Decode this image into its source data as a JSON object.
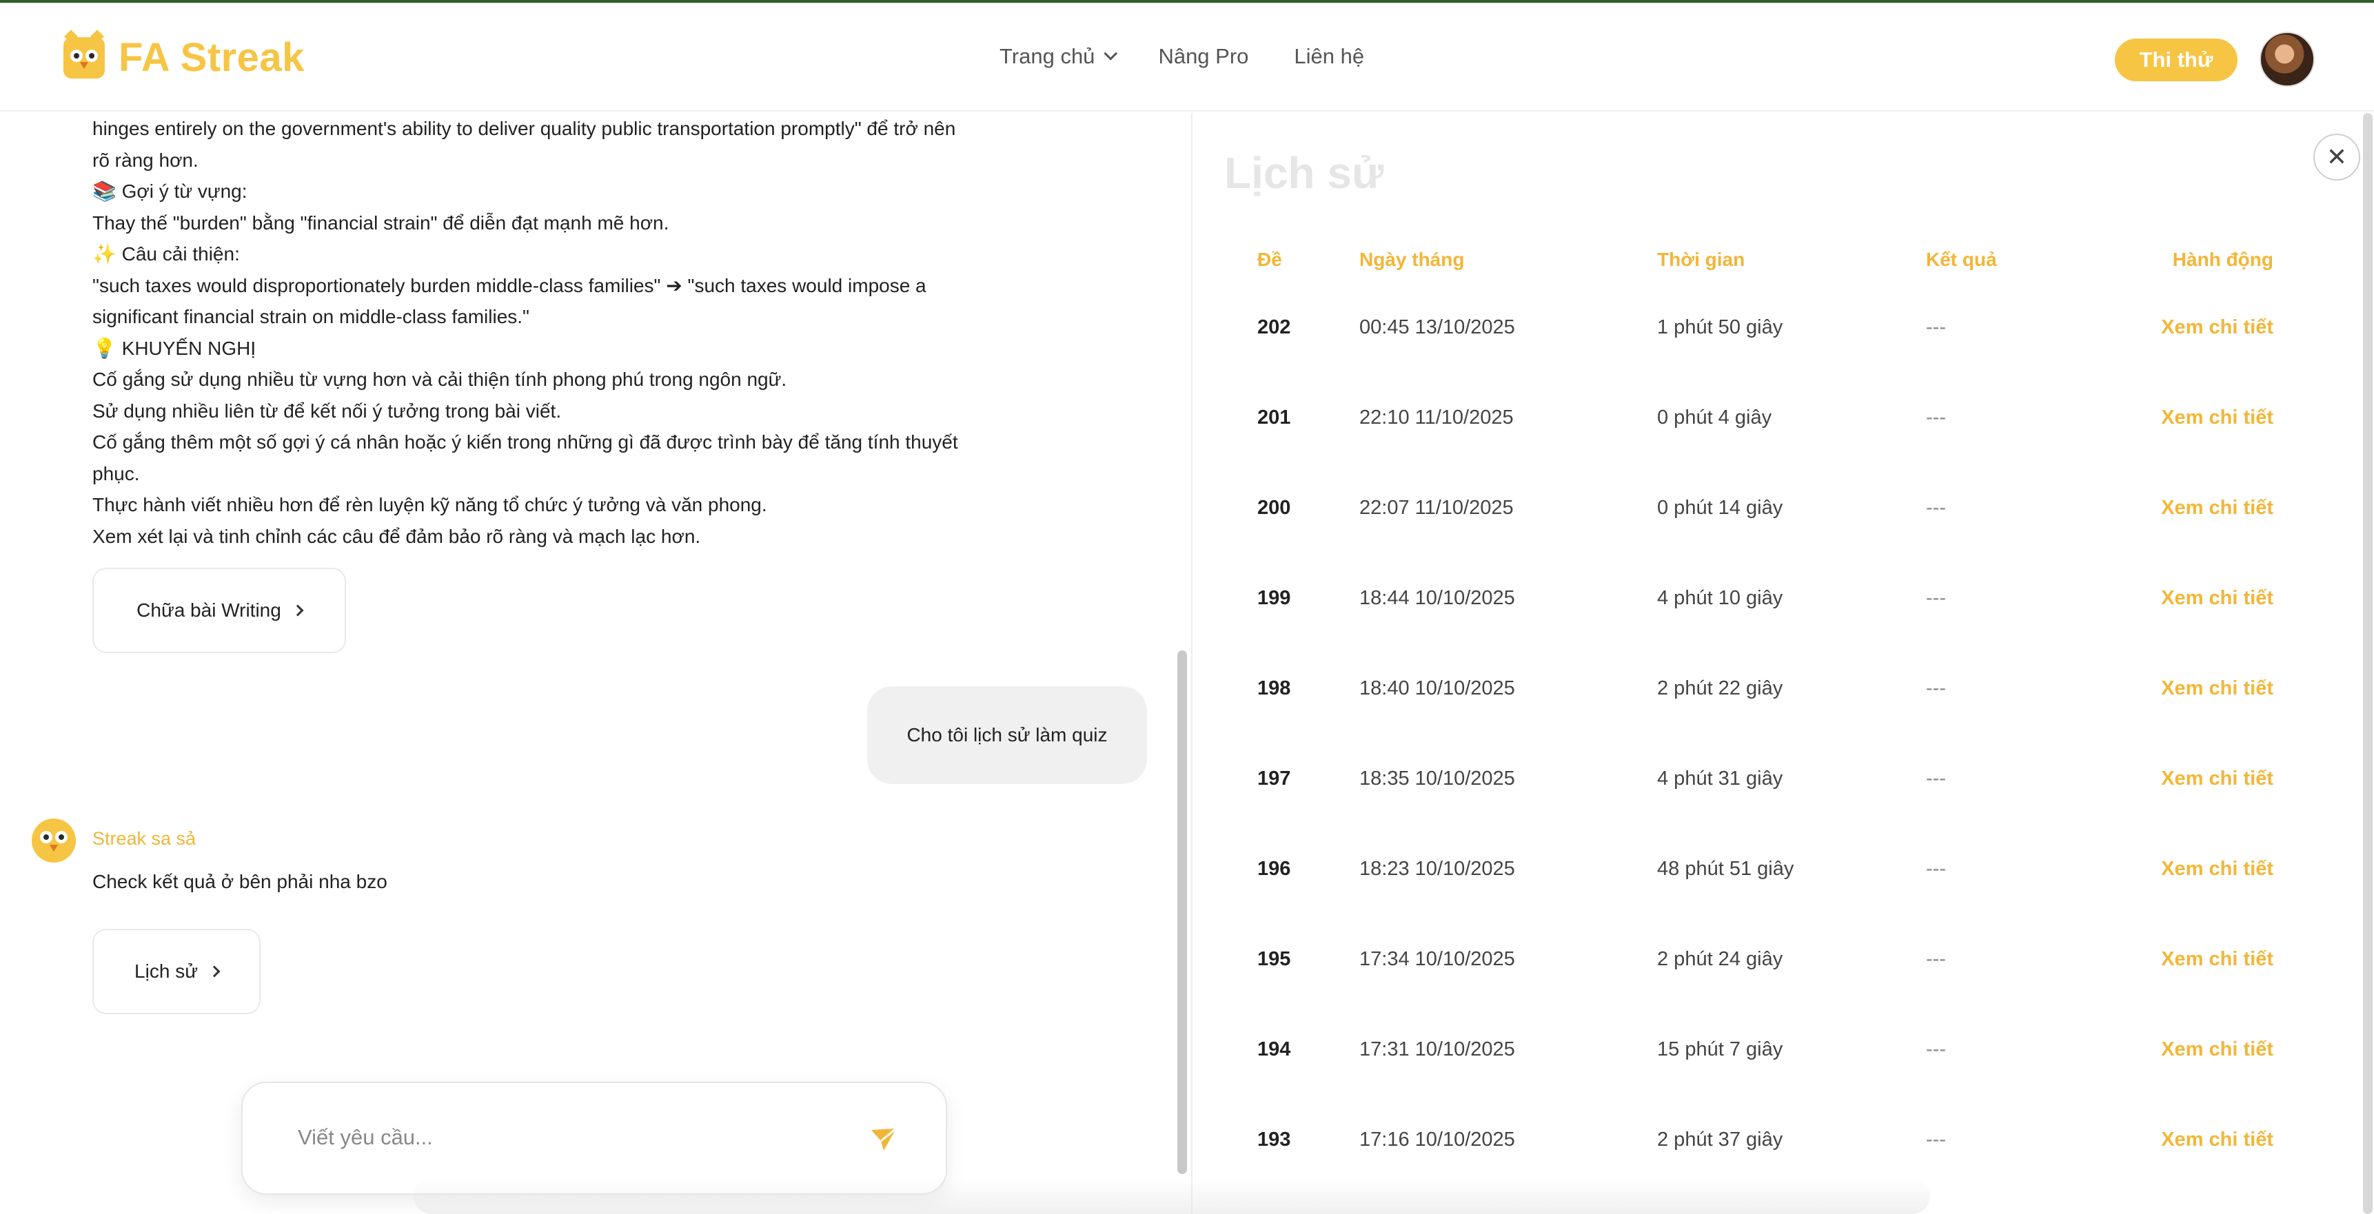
{
  "app": {
    "name": "FA Streak"
  },
  "nav": {
    "home": "Trang chủ",
    "pro": "Nâng Pro",
    "contact": "Liên hệ",
    "try_label": "Thi thử"
  },
  "chat": {
    "lines": [
      "hinges entirely on the government's ability to deliver quality public transportation promptly\" để trở nên",
      "rõ ràng hơn.",
      "📚 Gợi ý từ vựng:",
      "Thay thế \"burden\" bằng \"financial strain\" để diễn đạt mạnh mẽ hơn.",
      "✨ Câu cải thiện:",
      "\"such taxes would disproportionately burden middle-class families\" ➔ \"such taxes would impose a",
      "significant financial strain on middle-class families.\"",
      "💡 KHUYẾN NGHỊ",
      "Cố gắng sử dụng nhiều từ vựng hơn và cải thiện tính phong phú trong ngôn ngữ.",
      "Sử dụng nhiều liên từ để kết nối ý tưởng trong bài viết.",
      "Cố gắng thêm một số gợi ý cá nhân hoặc ý kiến trong những gì đã được trình bày để tăng tính thuyết",
      "phục.",
      "Thực hành viết nhiều hơn để rèn luyện kỹ năng tổ chức ý tưởng và văn phong.",
      "Xem xét lại và tinh chỉnh các câu để đảm bảo rõ ràng và mạch lạc hơn."
    ],
    "writing_button": "Chữa bài Writing",
    "user_message": "Cho tôi lịch sử làm quiz",
    "bot_name": "Streak sa sả",
    "bot_message": "Check kết quả ở bên phải nha bzo",
    "history_button": "Lịch sử",
    "input_placeholder": "Viết yêu cầu..."
  },
  "history": {
    "title": "Lịch sử",
    "columns": [
      "Đề",
      "Ngày tháng",
      "Thời gian",
      "Kết quả",
      "Hành động"
    ],
    "rows": [
      {
        "id": "202",
        "date": "00:45 13/10/2025",
        "duration": "1 phút 50 giây",
        "result": "---",
        "action": "Xem chi tiết"
      },
      {
        "id": "201",
        "date": "22:10 11/10/2025",
        "duration": "0 phút 4 giây",
        "result": "---",
        "action": "Xem chi tiết"
      },
      {
        "id": "200",
        "date": "22:07 11/10/2025",
        "duration": "0 phút 14 giây",
        "result": "---",
        "action": "Xem chi tiết"
      },
      {
        "id": "199",
        "date": "18:44 10/10/2025",
        "duration": "4 phút 10 giây",
        "result": "---",
        "action": "Xem chi tiết"
      },
      {
        "id": "198",
        "date": "18:40 10/10/2025",
        "duration": "2 phút 22 giây",
        "result": "---",
        "action": "Xem chi tiết"
      },
      {
        "id": "197",
        "date": "18:35 10/10/2025",
        "duration": "4 phút 31 giây",
        "result": "---",
        "action": "Xem chi tiết"
      },
      {
        "id": "196",
        "date": "18:23 10/10/2025",
        "duration": "48 phút 51 giây",
        "result": "---",
        "action": "Xem chi tiết"
      },
      {
        "id": "195",
        "date": "17:34 10/10/2025",
        "duration": "2 phút 24 giây",
        "result": "---",
        "action": "Xem chi tiết"
      },
      {
        "id": "194",
        "date": "17:31 10/10/2025",
        "duration": "15 phút 7 giây",
        "result": "---",
        "action": "Xem chi tiết"
      },
      {
        "id": "193",
        "date": "17:16 10/10/2025",
        "duration": "2 phút 37 giây",
        "result": "---",
        "action": "Xem chi tiết"
      }
    ]
  },
  "colors": {
    "brand": "#f7c544",
    "accent_text": "#f2b637"
  },
  "icons": [
    "logo-owl-icon",
    "chevron-down-icon",
    "chevron-right-icon",
    "close-icon",
    "send-icon",
    "bot-avatar-icon"
  ]
}
